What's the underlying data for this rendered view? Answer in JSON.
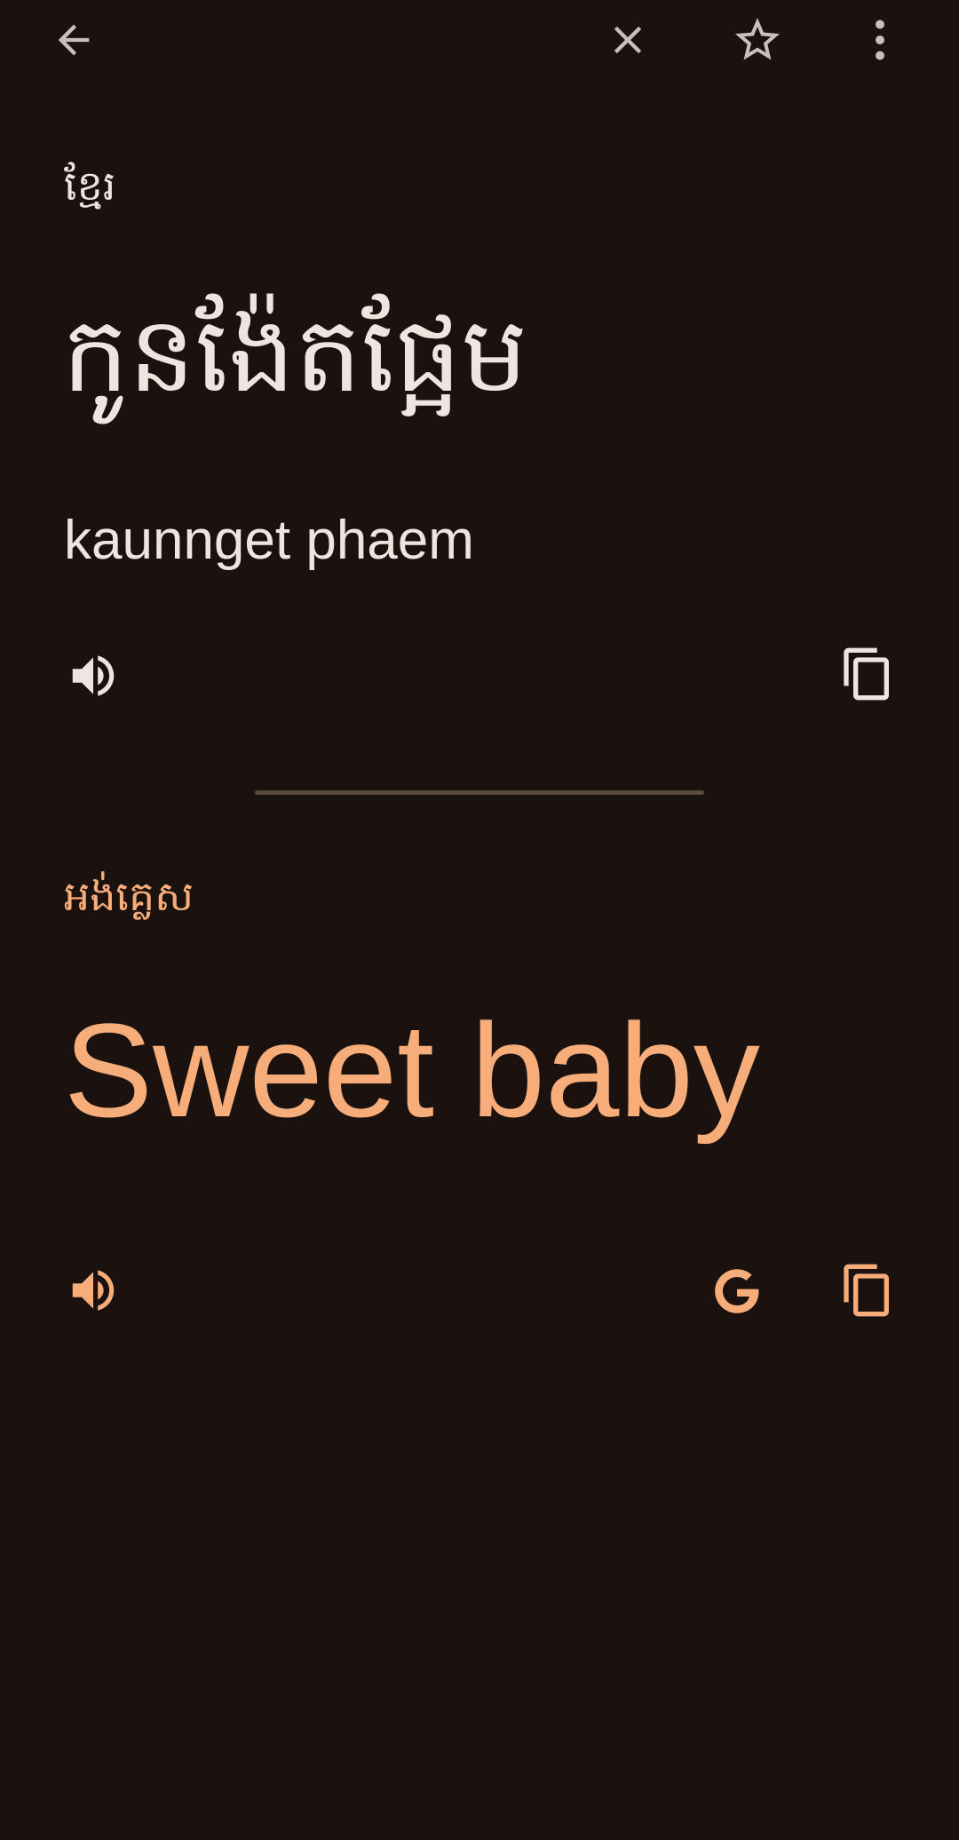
{
  "toolbar": {
    "back_icon": "arrow-left-icon",
    "clear_icon": "close-icon",
    "save_icon": "star-outline-icon",
    "menu_icon": "more-vert-icon"
  },
  "source": {
    "language": "ខ្មែរ",
    "text": "កូនង៉ែតផ្អែម",
    "transliteration": "kaunnget phaem",
    "listen_icon": "speaker-icon",
    "copy_icon": "copy-icon"
  },
  "target": {
    "language": "អង់គ្លេស",
    "text": "Sweet baby",
    "listen_icon": "speaker-icon",
    "google_icon": "google-g-icon",
    "copy_icon": "copy-icon"
  },
  "colors": {
    "background": "#1b1210",
    "source_text": "#efe4e0",
    "accent": "#f7ad7a",
    "divider": "#5a4a3c"
  }
}
